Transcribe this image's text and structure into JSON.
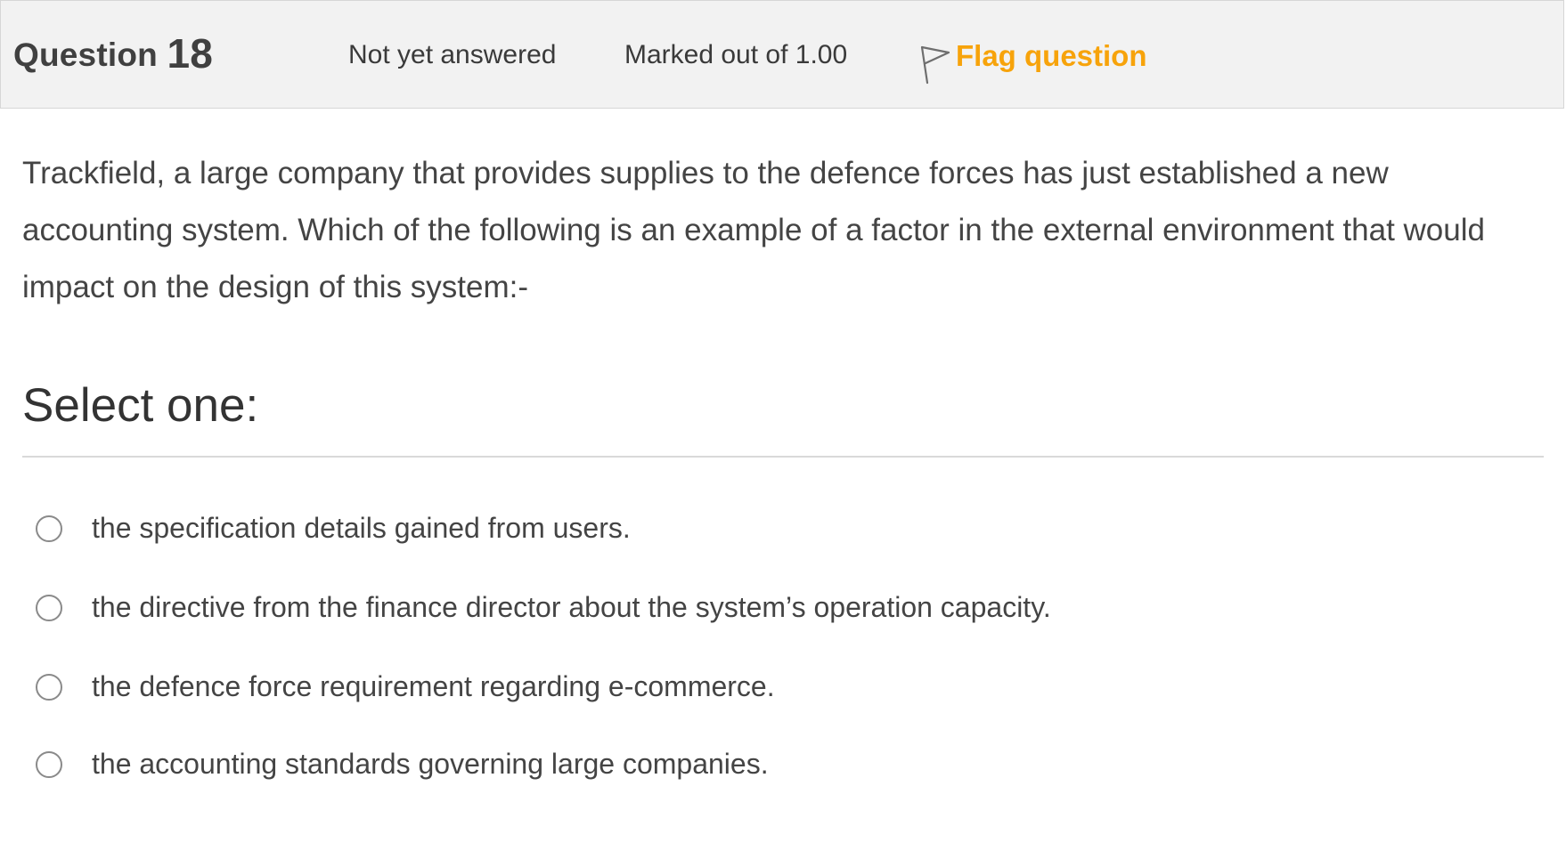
{
  "header": {
    "title_prefix": "Question",
    "question_number": "18",
    "state": "Not yet answered",
    "grade": "Marked out of 1.00",
    "flag_label": "Flag question",
    "flag_color": "#f7a30b"
  },
  "question": {
    "text": "Trackfield, a large company that provides supplies to the defence forces has just established a new accounting system. Which of the following is an example of a factor in the external environment that would impact on the design of this system:-"
  },
  "answer_block": {
    "prompt": "Select one:",
    "options": [
      {
        "label": "the specification details gained from users.",
        "selected": false
      },
      {
        "label": "the directive from the finance director about the system’s operation capacity.",
        "selected": false
      },
      {
        "label": "the defence force requirement regarding e-commerce.",
        "selected": false
      },
      {
        "label": "the accounting standards governing large companies.",
        "selected": false
      }
    ]
  }
}
